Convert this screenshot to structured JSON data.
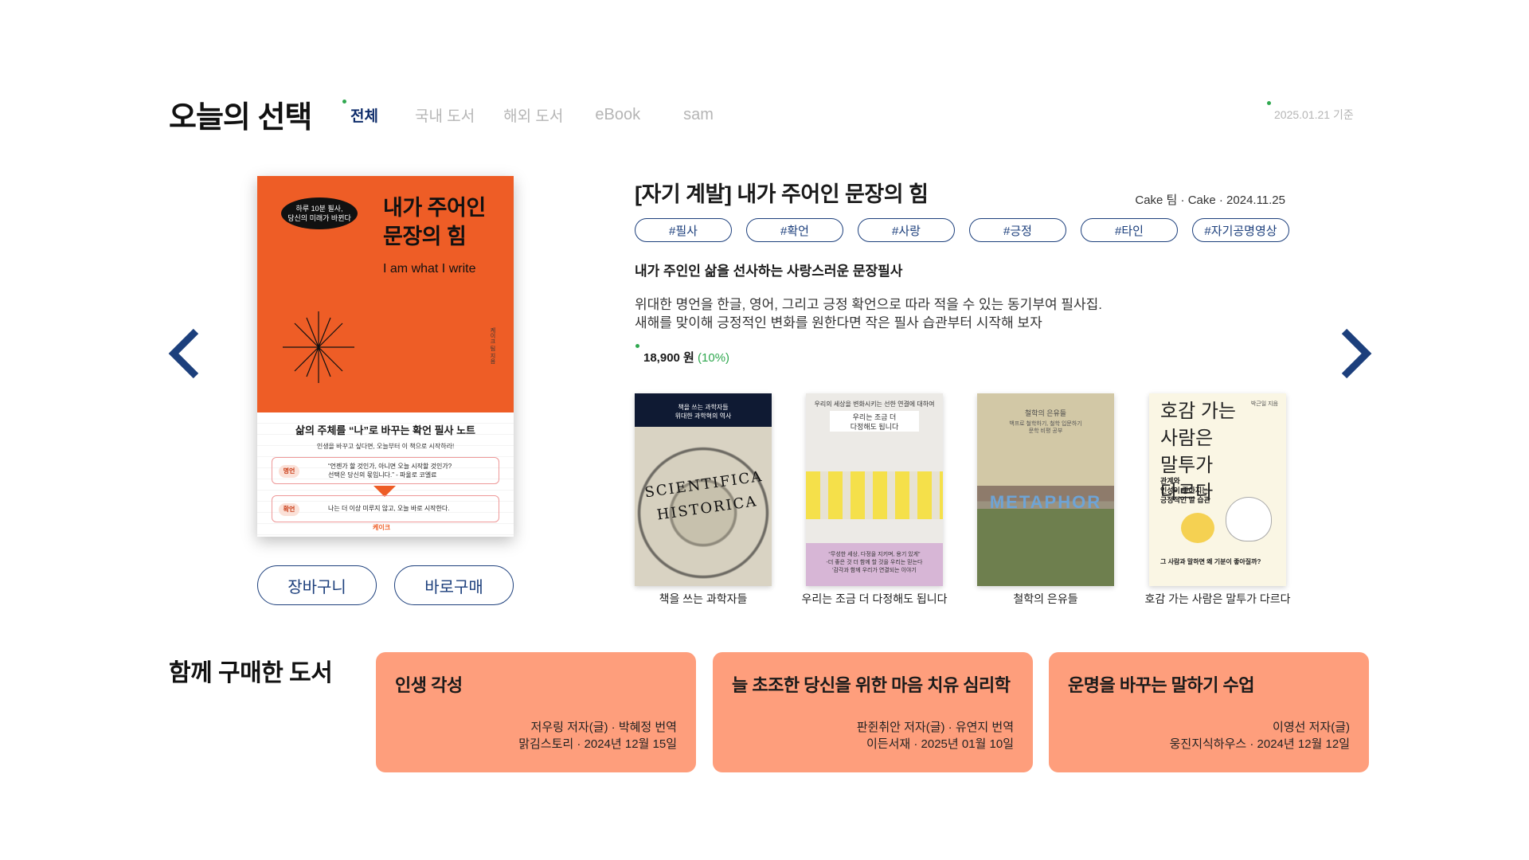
{
  "header": {
    "title": "오늘의 선택",
    "tabs": [
      {
        "label": "전체",
        "active": true
      },
      {
        "label": "국내 도서",
        "active": false
      },
      {
        "label": "해외 도서",
        "active": false
      },
      {
        "label": "eBook",
        "active": false
      },
      {
        "label": "sam",
        "active": false
      }
    ],
    "date_ref": "2025.01.21 기준"
  },
  "featured": {
    "cover": {
      "badge": "하루 10분 필사,\n당신의 미래가 바뀐다",
      "title": "내가 주어인\n문장의 힘",
      "subtitle": "I am what I write",
      "spine_text": "케이크 팀 지음",
      "bottom_heading": "삶의 주체를 “나”로 바꾸는 확언 필사 노트",
      "bottom_sub": "인생을 바꾸고 싶다면, 오늘부터 이 책으로 시작하라!",
      "quote_tag": "명언",
      "quote_text": "“언젠가 할 것인가, 아니면 오늘 시작할 것인가?\n선택은 당신의 몫입니다.” - 파울로 코엘료",
      "affirm_tag": "확언",
      "affirm_text": "나는 더 이상 미루지 않고, 오늘 바로 시작한다.",
      "publisher": "케이크"
    },
    "buttons": {
      "cart": "장바구니",
      "buy": "바로구매"
    },
    "title": "[자기 계발] 내가 주어인 문장의 힘",
    "meta": "Cake 팀 · Cake · 2024.11.25",
    "hashtags": [
      "#필사",
      "#확언",
      "#사랑",
      "#긍정",
      "#타인",
      "#자기공명영상"
    ],
    "headline": "내가 주인인 삶을 선사하는 사랑스러운 문장필사",
    "desc_line1": "위대한 명언을 한글, 영어, 그리고 긍정 확언으로 따라 적을 수 있는 동기부여 필사집.",
    "desc_line2": "새해를 맞이해 긍정적인 변화를 원한다면 작은 필사 습관부터 시작해 보자",
    "price": "18,900 원",
    "discount": "(10%)"
  },
  "related_books": [
    {
      "caption": "책을 쓰는 과학자들",
      "cover_top": "책을 쓰는 과학자들\n위대한 과학혁의 역사",
      "cover_big": "SCIENTIFICA HISTORICA"
    },
    {
      "caption": "우리는 조금 더 다정해도 됩니다",
      "cover_top": "우리의 세상을 변화시키는 선한 연결에 대하여",
      "cover_name": "우리는 조금 더\n다정해도 됩니다",
      "cover_bottom": "“무성한 세상, 다정을 지키며, 용기 있게”\n-더 좋은 것 더 함께 할 것을 우리는 믿는다\n'감각과 함께 우리가 연결되는 이야기"
    },
    {
      "caption": "철학의 은유들",
      "cover_top": "철학의 은유들",
      "cover_sub": "백프로 철학하기, 철학 입문하기\n문학 비평 공부",
      "cover_big": "METAPHOR"
    },
    {
      "caption": "호감 가는 사람은 말투가 다르다",
      "cover_author": "박근일 지음",
      "cover_title": "호감 가는\n사람은\n말투가\n다르다",
      "cover_sub": "관계와\n인성이 좋아지는\n긍정적인 말 습관",
      "cover_q": "그 사람과 말하면 왜 기분이 좋아질까?"
    }
  ],
  "together": {
    "title": "함께 구매한 도서",
    "cards": [
      {
        "title": "인생 각성",
        "authors": "저우링 저자(글) · 박혜정 번역",
        "pub": "맑김스토리 · 2024년 12월 15일"
      },
      {
        "title": "늘 초조한 당신을 위한 마음 치유 심리학",
        "authors": "판쥔취안 저자(글) · 유연지 번역",
        "pub": "이든서재 · 2025년 01월 10일"
      },
      {
        "title": "운명을 바꾸는 말하기 수업",
        "authors": "이영선 저자(글)",
        "pub": "웅진지식하우스 · 2024년 12월 12일"
      }
    ]
  },
  "colors": {
    "accent_navy": "#1c3f7c",
    "accent_green": "#2fa84f",
    "cover_orange": "#ee5d26",
    "card_salmon": "#fe9e7c"
  },
  "icons": {
    "prev": "chevron-left-icon",
    "next": "chevron-right-icon"
  }
}
